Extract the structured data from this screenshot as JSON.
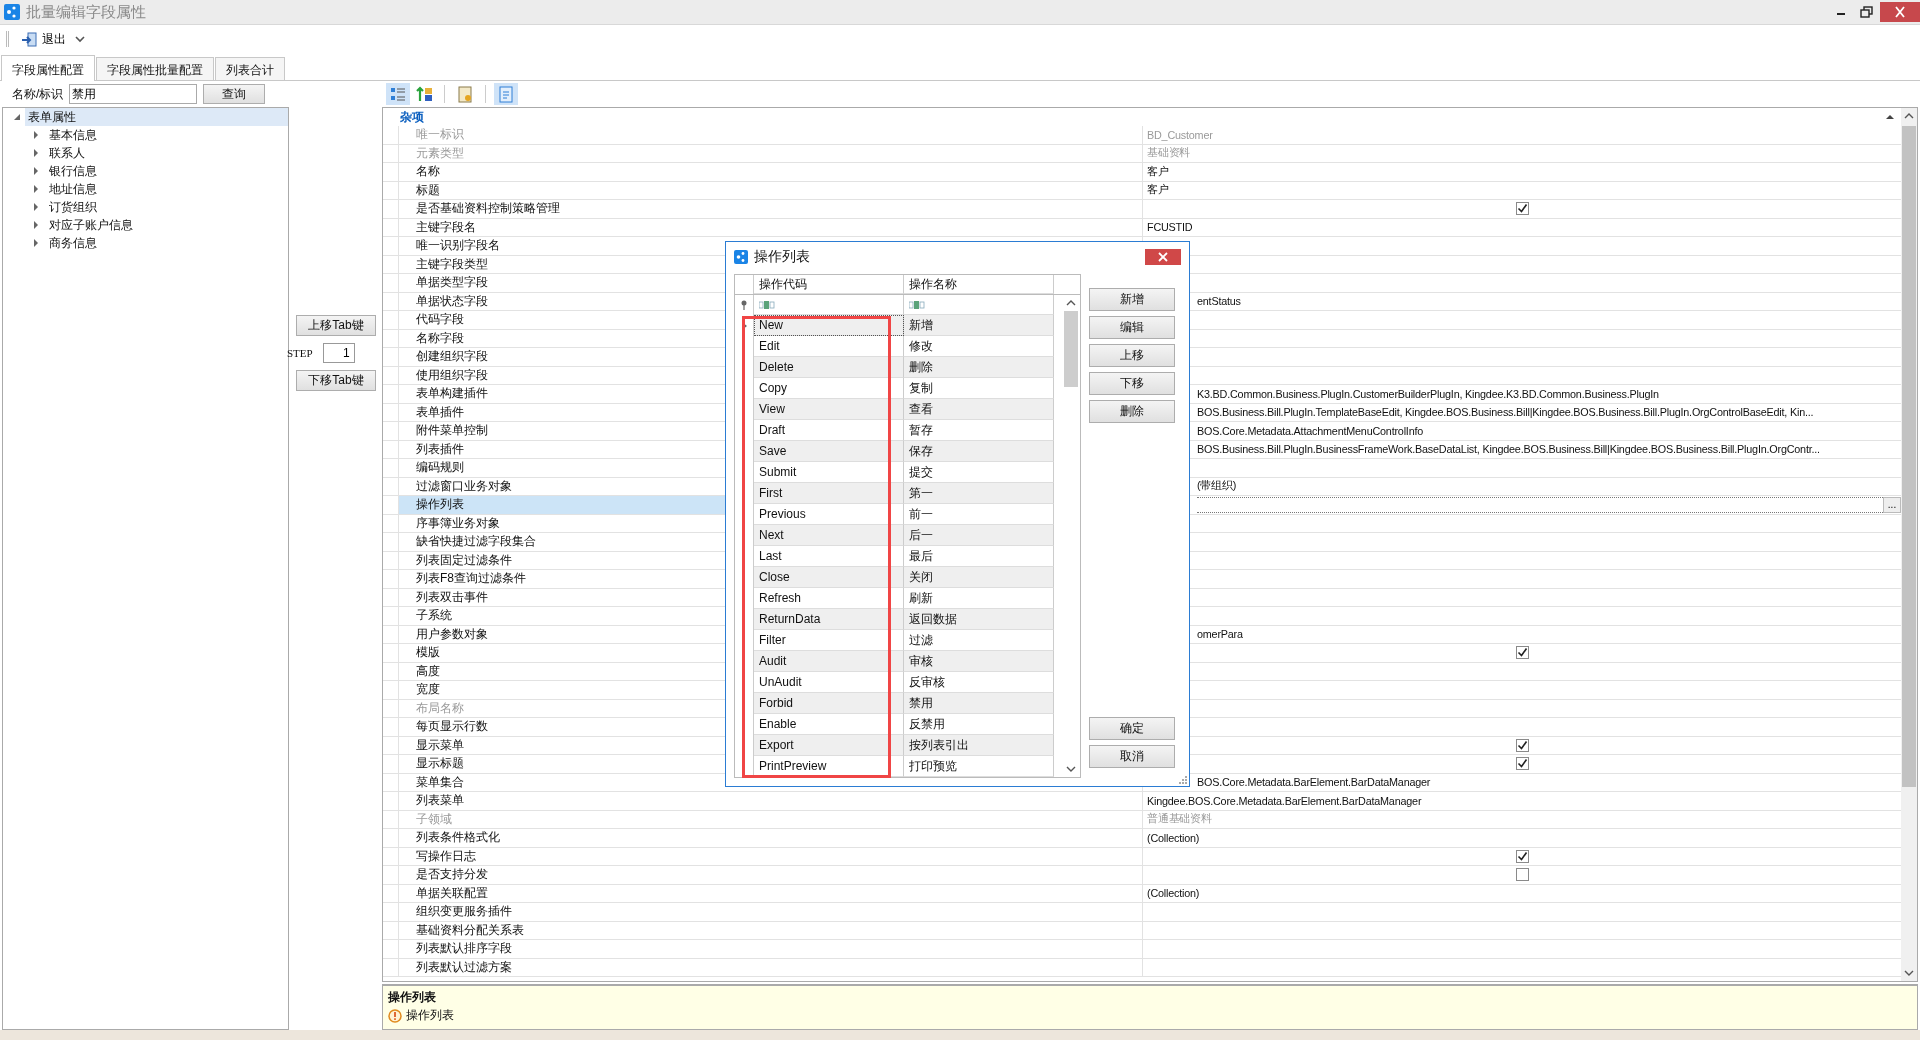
{
  "window": {
    "title": "批量编辑字段属性"
  },
  "toolbar": {
    "items": [
      {
        "label": "退出",
        "kind": "exit"
      }
    ]
  },
  "tabs": [
    {
      "label": "字段属性配置",
      "selected": true
    },
    {
      "label": "字段属性批量配置",
      "selected": false
    },
    {
      "label": "列表合计",
      "selected": false
    }
  ],
  "search": {
    "label": "名称/标识",
    "value": "禁用",
    "button": "查询"
  },
  "tree": {
    "items": [
      {
        "label": "表单属性",
        "expanded": true,
        "selected": true,
        "children": [
          {
            "label": "基本信息",
            "expanded": false,
            "selected": false
          },
          {
            "label": "联系人",
            "expanded": false,
            "selected": false
          },
          {
            "label": "银行信息",
            "expanded": false,
            "selected": false
          },
          {
            "label": "地址信息",
            "expanded": false,
            "selected": false
          },
          {
            "label": "订货组织",
            "expanded": false,
            "selected": false
          },
          {
            "label": "对应子账户信息",
            "expanded": false,
            "selected": false
          },
          {
            "label": "商务信息",
            "expanded": false,
            "selected": false
          }
        ]
      }
    ]
  },
  "tab_order": {
    "up_button": "上移Tab键",
    "step_label": "STEP",
    "step_value": "1",
    "down_button": "下移Tab键"
  },
  "grid_toolbar": [
    {
      "kind": "categorized",
      "selected": true
    },
    {
      "kind": "alphabetical",
      "selected": false
    },
    {
      "kind": "pages",
      "selected": false
    },
    {
      "kind": "events",
      "selected": true
    }
  ],
  "property_grid": {
    "category": "杂项",
    "rows": [
      {
        "label": "唯一标识",
        "kind": "text",
        "value": "BD_Customer",
        "disabled": true,
        "selected": false
      },
      {
        "label": "元素类型",
        "kind": "text",
        "value": "基础资料",
        "disabled": true,
        "selected": false
      },
      {
        "label": "名称",
        "kind": "text",
        "value": "客户",
        "disabled": false,
        "selected": false
      },
      {
        "label": "标题",
        "kind": "text",
        "value": "客户",
        "disabled": false,
        "selected": false
      },
      {
        "label": "是否基础资料控制策略管理",
        "kind": "check",
        "checked": true,
        "disabled": false,
        "selected": false
      },
      {
        "label": "主键字段名",
        "kind": "text",
        "value": "FCUSTID",
        "disabled": false,
        "selected": false
      },
      {
        "label": "唯一识别字段名",
        "kind": "text",
        "disabled": false,
        "selected": false
      },
      {
        "label": "主键字段类型",
        "kind": "text",
        "disabled": false,
        "selected": false
      },
      {
        "label": "单据类型字段",
        "kind": "text",
        "disabled": false,
        "selected": false
      },
      {
        "label": "单据状态字段",
        "kind": "text",
        "value": "entStatus",
        "disabled": false,
        "selected": false
      },
      {
        "label": "代码字段",
        "kind": "text",
        "disabled": false,
        "selected": false
      },
      {
        "label": "名称字段",
        "kind": "text",
        "disabled": false,
        "selected": false
      },
      {
        "label": "创建组织字段",
        "kind": "text",
        "disabled": false,
        "selected": false
      },
      {
        "label": "使用组织字段",
        "kind": "text",
        "disabled": false,
        "selected": false
      },
      {
        "label": "表单构建插件",
        "kind": "text",
        "value": "K3.BD.Common.Business.PlugIn.CustomerBuilderPlugIn, Kingdee.K3.BD.Common.Business.PlugIn",
        "disabled": false,
        "selected": false
      },
      {
        "label": "表单插件",
        "kind": "text",
        "value": "BOS.Business.Bill.PlugIn.TemplateBaseEdit, Kingdee.BOS.Business.Bill|Kingdee.BOS.Business.Bill.PlugIn.OrgControlBaseEdit, Kin...",
        "disabled": false,
        "selected": false
      },
      {
        "label": "附件菜单控制",
        "kind": "text",
        "value": "BOS.Core.Metadata.AttachmentMenuControlInfo",
        "disabled": false,
        "selected": false
      },
      {
        "label": "列表插件",
        "kind": "text",
        "value": "BOS.Business.Bill.PlugIn.BusinessFrameWork.BaseDataList, Kingdee.BOS.Business.Bill|Kingdee.BOS.Business.Bill.PlugIn.OrgContr...",
        "disabled": false,
        "selected": false
      },
      {
        "label": "编码规则",
        "kind": "text",
        "disabled": false,
        "selected": false
      },
      {
        "label": "过滤窗口业务对象",
        "kind": "text",
        "value": "(带组织)",
        "disabled": false,
        "selected": false
      },
      {
        "label": "操作列表",
        "kind": "button",
        "button": "...",
        "disabled": false,
        "selected": true
      },
      {
        "label": "序事簿业务对象",
        "kind": "text",
        "disabled": false,
        "selected": false
      },
      {
        "label": "缺省快捷过滤字段集合",
        "kind": "text",
        "disabled": false,
        "selected": false
      },
      {
        "label": "列表固定过滤条件",
        "kind": "text",
        "disabled": false,
        "selected": false
      },
      {
        "label": "列表F8查询过滤条件",
        "kind": "text",
        "disabled": false,
        "selected": false
      },
      {
        "label": "列表双击事件",
        "kind": "text",
        "disabled": false,
        "selected": false
      },
      {
        "label": "子系统",
        "kind": "text",
        "disabled": false,
        "selected": false
      },
      {
        "label": "用户参数对象",
        "kind": "text",
        "value": "omerPara",
        "disabled": false,
        "selected": false
      },
      {
        "label": "模版",
        "kind": "check",
        "checked": true,
        "disabled": false,
        "selected": false
      },
      {
        "label": "高度",
        "kind": "text",
        "disabled": false,
        "selected": false
      },
      {
        "label": "宽度",
        "kind": "text",
        "disabled": false,
        "selected": false
      },
      {
        "label": "布局名称",
        "kind": "text",
        "disabled": true,
        "selected": false
      },
      {
        "label": "每页显示行数",
        "kind": "text",
        "disabled": false,
        "selected": false
      },
      {
        "label": "显示菜单",
        "kind": "check",
        "checked": true,
        "disabled": false,
        "selected": false
      },
      {
        "label": "显示标题",
        "kind": "check",
        "checked": true,
        "disabled": false,
        "selected": false
      },
      {
        "label": "菜单集合",
        "kind": "text",
        "value": "BOS.Core.Metadata.BarElement.BarDataManager",
        "disabled": false,
        "selected": false
      },
      {
        "label": "列表菜单",
        "kind": "text",
        "value": "Kingdee.BOS.Core.Metadata.BarElement.BarDataManager",
        "disabled": false,
        "selected": false
      },
      {
        "label": "子领域",
        "kind": "text",
        "value": "普通基础资料",
        "disabled": true,
        "selected": false
      },
      {
        "label": "列表条件格式化",
        "kind": "text",
        "value": "(Collection)",
        "disabled": false,
        "selected": false
      },
      {
        "label": "写操作日志",
        "kind": "check",
        "checked": true,
        "disabled": false,
        "selected": false
      },
      {
        "label": "是否支持分发",
        "kind": "check",
        "checked": false,
        "disabled": false,
        "selected": false
      },
      {
        "label": "单据关联配置",
        "kind": "text",
        "value": "(Collection)",
        "disabled": false,
        "selected": false
      },
      {
        "label": "组织变更服务插件",
        "kind": "text",
        "disabled": false,
        "selected": false
      },
      {
        "label": "基础资料分配关系表",
        "kind": "text",
        "disabled": false,
        "selected": false
      },
      {
        "label": "列表默认排序字段",
        "kind": "text",
        "disabled": false,
        "selected": false
      },
      {
        "label": "列表默认过滤方案",
        "kind": "text",
        "disabled": false,
        "selected": false
      }
    ]
  },
  "description": {
    "title": "操作列表",
    "text": "操作列表"
  },
  "dialog": {
    "title": "操作列表",
    "columns": [
      "操作代码",
      "操作名称"
    ],
    "highlight_frame": true,
    "rows": [
      {
        "code": "New",
        "name": "新增",
        "selected": true
      },
      {
        "code": "Edit",
        "name": "修改",
        "selected": false
      },
      {
        "code": "Delete",
        "name": "删除",
        "selected": false
      },
      {
        "code": "Copy",
        "name": "复制",
        "selected": false
      },
      {
        "code": "View",
        "name": "查看",
        "selected": false
      },
      {
        "code": "Draft",
        "name": "暂存",
        "selected": false
      },
      {
        "code": "Save",
        "name": "保存",
        "selected": false
      },
      {
        "code": "Submit",
        "name": "提交",
        "selected": false
      },
      {
        "code": "First",
        "name": "第一",
        "selected": false
      },
      {
        "code": "Previous",
        "name": "前一",
        "selected": false
      },
      {
        "code": "Next",
        "name": "后一",
        "selected": false
      },
      {
        "code": "Last",
        "name": "最后",
        "selected": false
      },
      {
        "code": "Close",
        "name": "关闭",
        "selected": false
      },
      {
        "code": "Refresh",
        "name": "刷新",
        "selected": false
      },
      {
        "code": "ReturnData",
        "name": "返回数据",
        "selected": false
      },
      {
        "code": "Filter",
        "name": "过滤",
        "selected": false
      },
      {
        "code": "Audit",
        "name": "审核",
        "selected": false
      },
      {
        "code": "UnAudit",
        "name": "反审核",
        "selected": false
      },
      {
        "code": "Forbid",
        "name": "禁用",
        "selected": false
      },
      {
        "code": "Enable",
        "name": "反禁用",
        "selected": false
      },
      {
        "code": "Export",
        "name": "按列表引出",
        "selected": false
      },
      {
        "code": "PrintPreview",
        "name": "打印预览",
        "selected": false
      }
    ],
    "buttons": [
      "新增",
      "编辑",
      "上移",
      "下移",
      "删除"
    ],
    "footer_buttons": [
      "确定",
      "取消"
    ]
  }
}
